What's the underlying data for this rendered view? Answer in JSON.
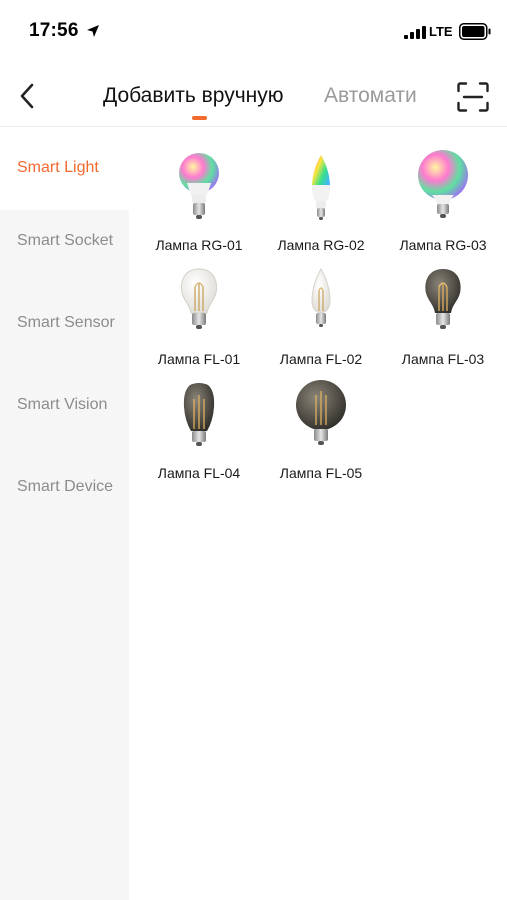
{
  "status_bar": {
    "time": "17:56",
    "network": "LTE"
  },
  "header": {
    "tabs": [
      {
        "label": "Добавить вручную",
        "active": true
      },
      {
        "label": "Автоматически",
        "active": false
      }
    ],
    "accent_color": "#f26a2e"
  },
  "sidebar": {
    "items": [
      {
        "label": "Smart Light",
        "active": true
      },
      {
        "label": "Smart Socket",
        "active": false
      },
      {
        "label": "Smart Sensor",
        "active": false
      },
      {
        "label": "Smart Vision",
        "active": false
      },
      {
        "label": "Smart Device",
        "active": false
      }
    ]
  },
  "products": [
    {
      "label": "Лампа RG-01",
      "icon": "rgb-bulb-icon"
    },
    {
      "label": "Лампа RG-02",
      "icon": "rgb-candle-bulb-icon"
    },
    {
      "label": "Лампа RG-03",
      "icon": "rgb-globe-bulb-icon"
    },
    {
      "label": "Лампа FL-01",
      "icon": "filament-bulb-icon"
    },
    {
      "label": "Лампа FL-02",
      "icon": "filament-candle-bulb-icon"
    },
    {
      "label": "Лампа FL-03",
      "icon": "smoky-filament-bulb-icon"
    },
    {
      "label": "Лампа FL-04",
      "icon": "smoky-edison-bulb-icon"
    },
    {
      "label": "Лампа FL-05",
      "icon": "smoky-globe-bulb-icon"
    }
  ]
}
